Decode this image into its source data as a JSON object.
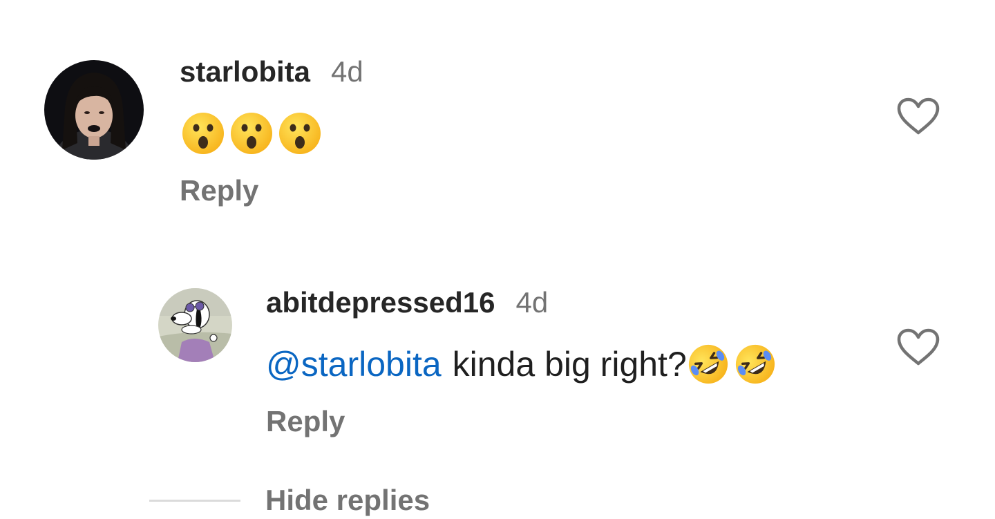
{
  "comments": [
    {
      "username": "starlobita",
      "time": "4d",
      "emojis": [
        "astonished-face-icon",
        "astonished-face-icon",
        "astonished-face-icon"
      ],
      "reply_label": "Reply"
    }
  ],
  "replies": [
    {
      "username": "abitdepressed16",
      "time": "4d",
      "mention": "@starlobita",
      "text": "kinda big right?",
      "emojis": [
        "rolling-on-floor-laughing-icon",
        "rolling-on-floor-laughing-icon"
      ],
      "reply_label": "Reply"
    }
  ],
  "hide_replies_label": "Hide replies",
  "colors": {
    "text_primary": "#262626",
    "text_secondary": "#737373",
    "mention": "#0a66c2",
    "divider": "#dbdbdb"
  }
}
